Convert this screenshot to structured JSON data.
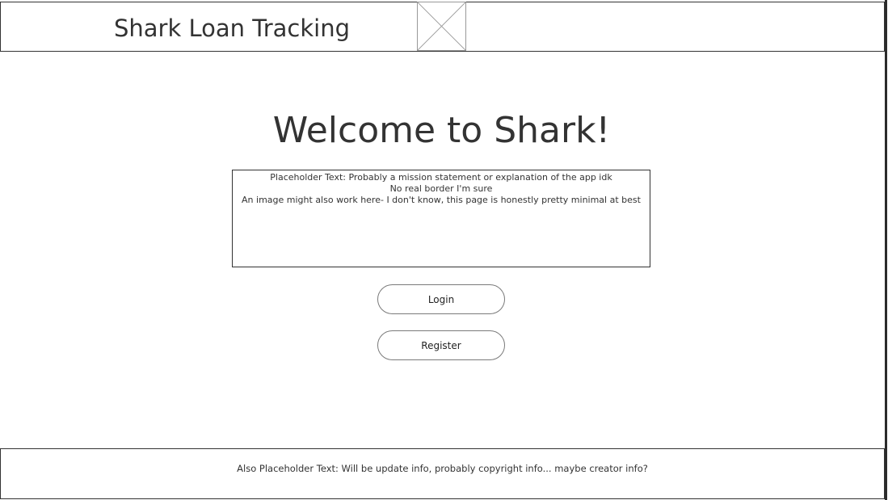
{
  "header": {
    "app_title": "Shark Loan Tracking",
    "logo_icon": "image-placeholder-icon"
  },
  "main": {
    "welcome_heading": "Welcome to Shark!",
    "mission_lines": [
      "Placeholder Text: Probably a mission statement or explanation of the app idk",
      "No real border I'm sure",
      "An image might also work here- I don't know, this page is honestly pretty minimal at best"
    ],
    "login_label": "Login",
    "register_label": "Register"
  },
  "footer": {
    "text": "Also Placeholder Text: Will be update info, probably copyright info... maybe creator info?"
  }
}
